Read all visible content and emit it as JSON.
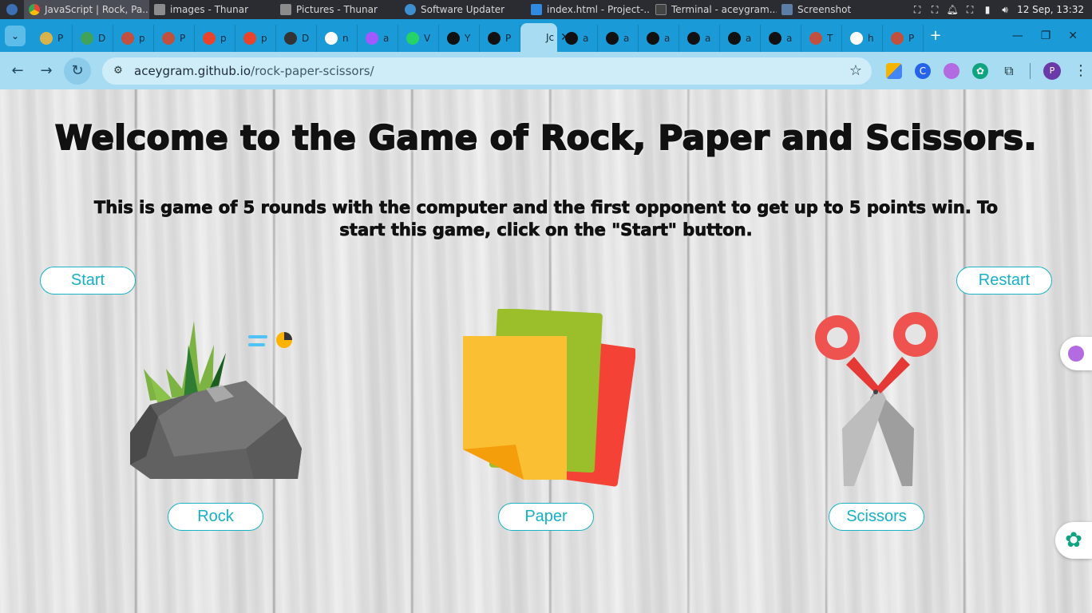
{
  "os_taskbar": {
    "tasks": [
      {
        "title": "JavaScript | Rock, Pa...",
        "color": "#ea4335",
        "active": true
      },
      {
        "title": "images - Thunar",
        "color": "#7a7a7a"
      },
      {
        "title": "Pictures - Thunar",
        "color": "#7a7a7a"
      },
      {
        "title": "Software Updater",
        "color": "#3d8fd1"
      },
      {
        "title": "index.html - Project-...",
        "color": "#2f8ae0"
      },
      {
        "title": "Terminal - aceygram...",
        "color": "#444"
      },
      {
        "title": "Screenshot",
        "color": "#5a7ea6"
      }
    ],
    "clock": "12 Sep, 13:32"
  },
  "browser": {
    "tabs": [
      {
        "label": "P",
        "icon": "#d9b24c"
      },
      {
        "label": "D",
        "icon": "#41a35a"
      },
      {
        "label": "p",
        "icon": "#c2503f"
      },
      {
        "label": "P",
        "icon": "#c2503f"
      },
      {
        "label": "p",
        "icon": "#e8442c"
      },
      {
        "label": "p",
        "icon": "#e8442c"
      },
      {
        "label": "D",
        "icon": "#333"
      },
      {
        "label": "n",
        "icon": "#ffffff"
      },
      {
        "label": "a",
        "icon": "#a259ff"
      },
      {
        "label": "V",
        "icon": "#25d366"
      },
      {
        "label": "Y",
        "icon": "#111"
      },
      {
        "label": "P",
        "icon": "#111"
      },
      {
        "label": "Jc",
        "icon": "#a8dcf3",
        "active": true
      },
      {
        "label": "a",
        "icon": "#111"
      },
      {
        "label": "a",
        "icon": "#111"
      },
      {
        "label": "a",
        "icon": "#111"
      },
      {
        "label": "a",
        "icon": "#111"
      },
      {
        "label": "a",
        "icon": "#111"
      },
      {
        "label": "a",
        "icon": "#111"
      },
      {
        "label": "T",
        "icon": "#c2503f"
      },
      {
        "label": "h",
        "icon": "#ffffff"
      },
      {
        "label": "P",
        "icon": "#c2503f"
      }
    ],
    "url_host": "aceygram.github.io",
    "url_path": "/rock-paper-scissors/",
    "profile_initial": "P"
  },
  "page": {
    "title": "Welcome to the Game of Rock, Paper and Scissors.",
    "intro": "This is game of 5 rounds with the computer and the first opponent to get up to 5 points win. To start this game, click on the \"Start\" button.",
    "start_label": "Start",
    "restart_label": "Restart",
    "choices": [
      {
        "label": "Rock"
      },
      {
        "label": "Paper"
      },
      {
        "label": "Scissors"
      }
    ],
    "accent": "#19b3c6"
  }
}
